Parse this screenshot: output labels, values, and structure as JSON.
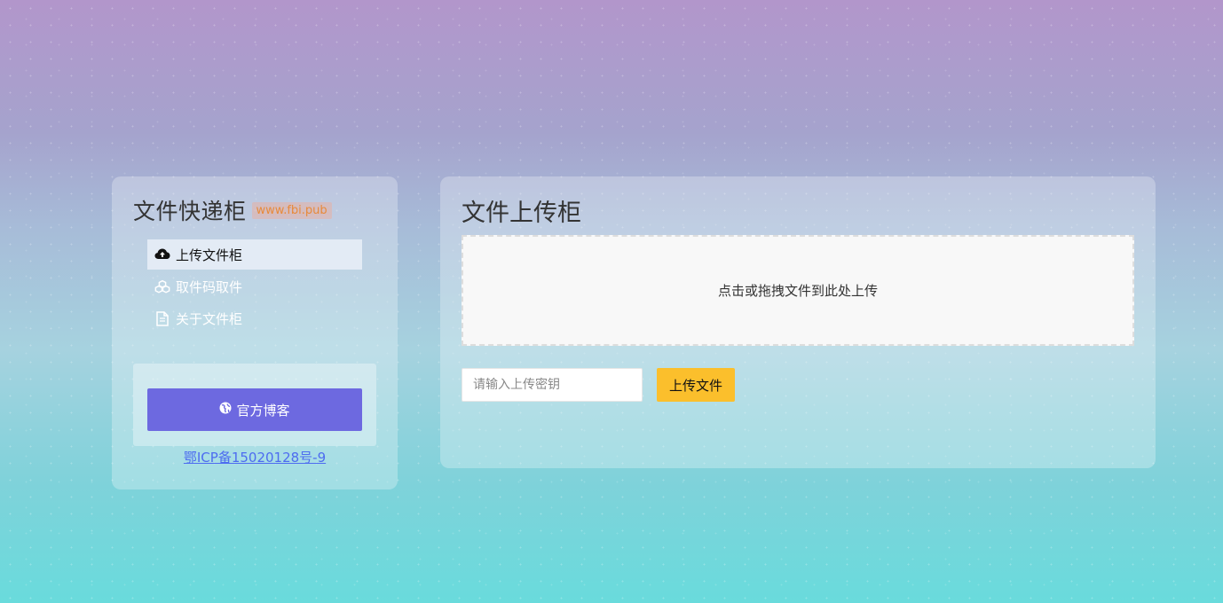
{
  "sidebar": {
    "brand_title": "文件快递柜",
    "brand_tag": "www.fbi.pub",
    "menu": [
      {
        "label": "上传文件柜",
        "icon": "cloud-upload-icon",
        "active": true
      },
      {
        "label": "取件码取件",
        "icon": "cubes-icon",
        "active": false
      },
      {
        "label": "关于文件柜",
        "icon": "file-icon",
        "active": false
      }
    ],
    "blog_button": {
      "label": "官方博客",
      "icon": "globe-icon"
    },
    "icp": "鄂ICP备15020128号-9"
  },
  "main": {
    "title": "文件上传柜",
    "dropzone_text": "点击或拖拽文件到此处上传",
    "key_input": {
      "placeholder": "请输入上传密钥",
      "value": ""
    },
    "upload_button": "上传文件"
  },
  "colors": {
    "accent_purple": "#6d69e0",
    "accent_yellow": "#fbbf2c",
    "link_blue": "#4d6cf0",
    "tag_orange": "#e88a3a"
  }
}
